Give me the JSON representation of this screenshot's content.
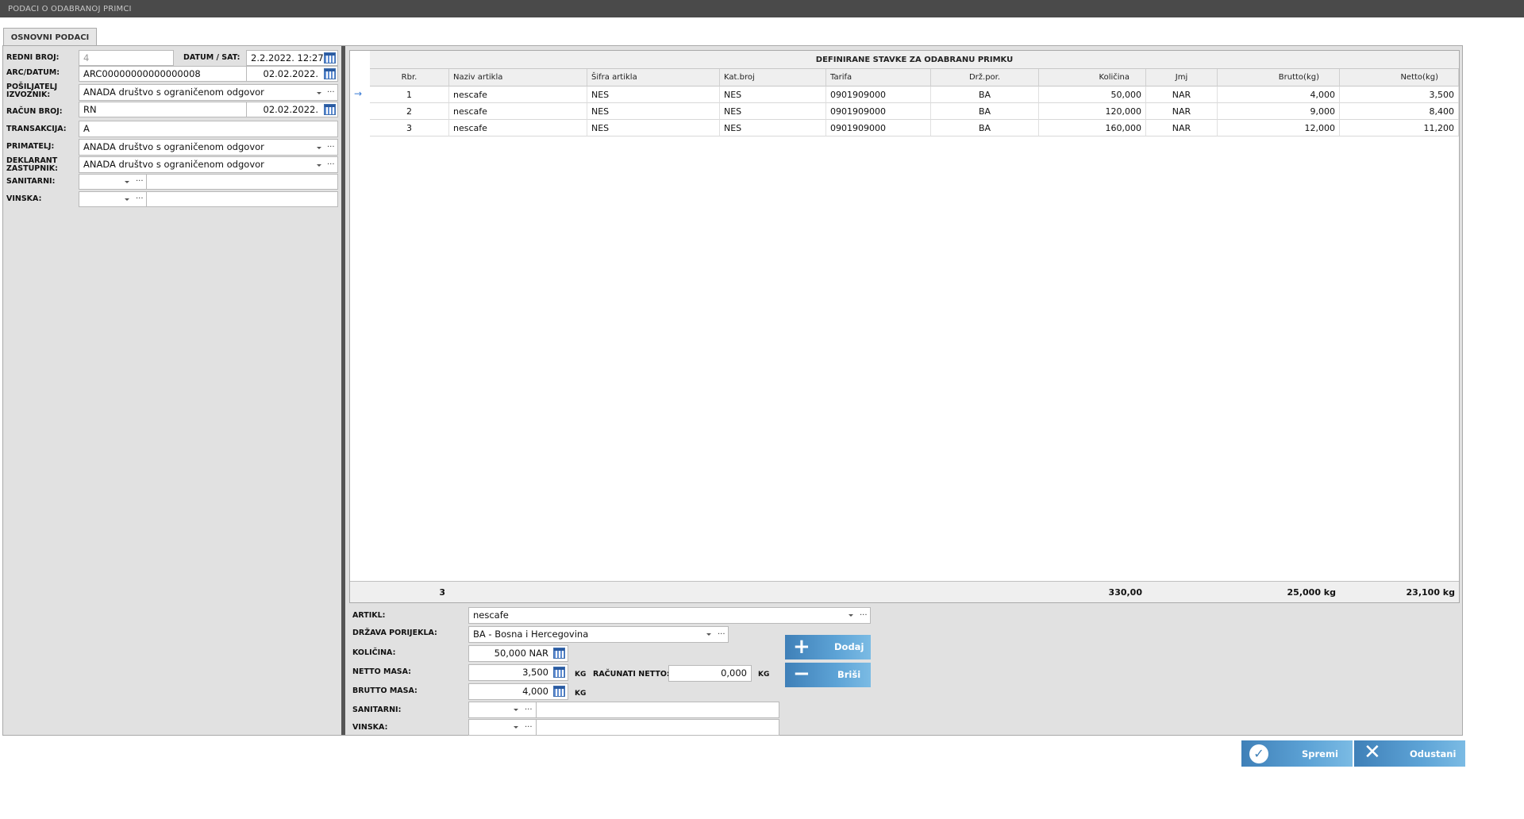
{
  "window": {
    "title": "PODACI O ODABRANOJ PRIMCI"
  },
  "tabs": [
    {
      "label": "OSNOVNI PODACI"
    }
  ],
  "header_form": {
    "redni_broj": {
      "label": "REDNI BROJ:",
      "value": "4"
    },
    "datum_sat": {
      "label": "DATUM / SAT:",
      "value": "2.2.2022. 12:27"
    },
    "arc_datum": {
      "label": "ARC/DATUM:",
      "value": "ARC00000000000000008",
      "date": "02.02.2022."
    },
    "posiljatelj": {
      "label_line1": "POŠILJATELJ",
      "label_line2": "IZVOZNIK:",
      "value": "ANADA društvo s ograničenom odgovor"
    },
    "racun_broj": {
      "label": "RAČUN BROJ:",
      "value": "RN",
      "date": "02.02.2022."
    },
    "transakcija": {
      "label": "TRANSAKCIJA:",
      "value": "A"
    },
    "primatelj": {
      "label": "PRIMATELJ:",
      "value": "ANADA društvo s ograničenom odgovor"
    },
    "deklarant": {
      "label_line1": "DEKLARANT",
      "label_line2": "ZASTUPNIK:",
      "value": "ANADA društvo s ograničenom odgovor"
    },
    "sanitarni": {
      "label": "SANITARNI:",
      "value": ""
    },
    "vinska": {
      "label": "VINSKA:",
      "value": ""
    }
  },
  "grid": {
    "title": "DEFINIRANE STAVKE ZA ODABRANU PRIMKU",
    "columns": [
      "Rbr.",
      "Naziv artikla",
      "Šifra artikla",
      "Kat.broj",
      "Tarifa",
      "Drž.por.",
      "Količina",
      "Jmj",
      "Brutto(kg)",
      "Netto(kg)"
    ],
    "rows": [
      {
        "rbr": "1",
        "naziv": "nescafe",
        "sifra": "NES",
        "kat": "NES",
        "tarifa": "0901909000",
        "drz": "BA",
        "kolicina": "50,000",
        "jmj": "NAR",
        "brutto": "4,000",
        "netto": "3,500"
      },
      {
        "rbr": "2",
        "naziv": "nescafe",
        "sifra": "NES",
        "kat": "NES",
        "tarifa": "0901909000",
        "drz": "BA",
        "kolicina": "120,000",
        "jmj": "NAR",
        "brutto": "9,000",
        "netto": "8,400"
      },
      {
        "rbr": "3",
        "naziv": "nescafe",
        "sifra": "NES",
        "kat": "NES",
        "tarifa": "0901909000",
        "drz": "BA",
        "kolicina": "160,000",
        "jmj": "NAR",
        "brutto": "12,000",
        "netto": "11,200"
      }
    ],
    "current_row_indicator": "→",
    "totals": {
      "count": "3",
      "kolicina": "330,00",
      "brutto": "25,000 kg",
      "netto": "23,100 kg"
    }
  },
  "item_form": {
    "artikl": {
      "label": "ARTIKL:",
      "value": "nescafe"
    },
    "drzava": {
      "label": "DRŽAVA PORIJEKLA:",
      "value": "BA - Bosna i Hercegovina"
    },
    "kolicina": {
      "label": "KOLIČINA:",
      "value": "50,000 NAR"
    },
    "netto": {
      "label": "NETTO MASA:",
      "value": "3,500",
      "unit": "KG"
    },
    "racunati_netto": {
      "label": "RAČUNATI NETTO:",
      "value": "0,000",
      "unit": "KG"
    },
    "brutto": {
      "label": "BRUTTO MASA:",
      "value": "4,000",
      "unit": "KG"
    },
    "sanitarni": {
      "label": "SANITARNI:",
      "value": ""
    },
    "vinska": {
      "label": "VINSKA:",
      "value": ""
    }
  },
  "buttons": {
    "dodaj": "Dodaj",
    "brisi": "Briši",
    "spremi": "Spremi",
    "odustani": "Odustani"
  }
}
